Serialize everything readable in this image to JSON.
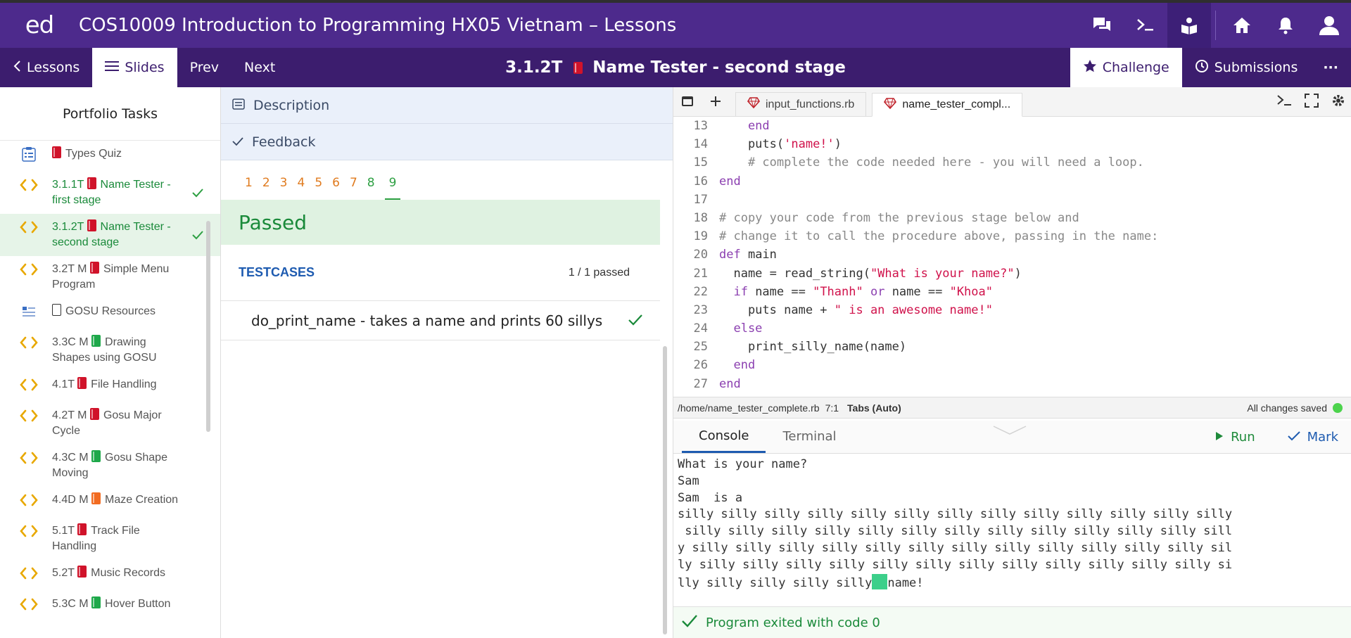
{
  "app": {
    "logo": "ed",
    "course_title": "COS10009 Introduction to Programming HX05 Vietnam – Lessons"
  },
  "subbar": {
    "lessons_label": "Lessons",
    "slides_label": "Slides",
    "prev_label": "Prev",
    "next_label": "Next",
    "slide_title_code": "3.1.2T",
    "slide_title_text": "Name Tester - second stage",
    "challenge_label": "Challenge",
    "submissions_label": "Submissions",
    "more_label": "···"
  },
  "sidebar": {
    "heading": "Portfolio Tasks",
    "items": [
      {
        "icon": "quiz-icon",
        "book": "red",
        "label": "Types Quiz",
        "active": false,
        "done": false
      },
      {
        "icon": "code-icon",
        "book": "red",
        "label_prefix": "3.1.1T",
        "label": "Name Tester - first stage",
        "active": false,
        "done": true
      },
      {
        "icon": "code-icon",
        "book": "red",
        "label_prefix": "3.1.2T",
        "label": "Name Tester - second stage",
        "active": true,
        "done": true
      },
      {
        "icon": "code-icon",
        "book": "red",
        "label_prefix": "3.2T M",
        "label": "Simple Menu Program",
        "active": false,
        "done": false
      },
      {
        "icon": "document-icon",
        "book": "outline",
        "label": "GOSU Resources",
        "active": false,
        "done": false
      },
      {
        "icon": "code-icon",
        "book": "green",
        "label_prefix": "3.3C M",
        "label": "Drawing Shapes using GOSU",
        "active": false,
        "done": false
      },
      {
        "icon": "code-icon",
        "book": "red",
        "label_prefix": "4.1T",
        "label": "File Handling",
        "active": false,
        "done": false
      },
      {
        "icon": "code-icon",
        "book": "red",
        "label_prefix": "4.2T M",
        "label": "Gosu Major Cycle",
        "active": false,
        "done": false
      },
      {
        "icon": "code-icon",
        "book": "green",
        "label_prefix": "4.3C M",
        "label": "Gosu Shape Moving",
        "active": false,
        "done": false
      },
      {
        "icon": "code-icon",
        "book": "orange",
        "label_prefix": "4.4D M",
        "label": "Maze Creation",
        "active": false,
        "done": false
      },
      {
        "icon": "code-icon",
        "book": "red",
        "label_prefix": "5.1T",
        "label": "Track File Handling",
        "active": false,
        "done": false
      },
      {
        "icon": "code-icon",
        "book": "red",
        "label_prefix": "5.2T",
        "label": "Music Records",
        "active": false,
        "done": false
      },
      {
        "icon": "code-icon",
        "book": "green",
        "label_prefix": "5.3C M",
        "label": "Hover Button",
        "active": false,
        "done": false
      }
    ]
  },
  "middle": {
    "description_label": "Description",
    "feedback_label": "Feedback",
    "attempts": [
      "1",
      "2",
      "3",
      "4",
      "5",
      "6",
      "7",
      "8",
      "9"
    ],
    "selected_attempt": "9",
    "status": "Passed",
    "testcases_label": "TESTCASES",
    "testcases_count": "1 / 1 passed",
    "testcases": [
      {
        "name": "do_print_name - takes a name and prints 60 sillys",
        "passed": true
      }
    ]
  },
  "editor": {
    "tabs": [
      "input_functions.rb",
      "name_tester_compl..."
    ],
    "active_tab": 1,
    "lines": [
      {
        "n": "13",
        "code": [
          [
            "kw",
            "    end"
          ]
        ]
      },
      {
        "n": "14",
        "code": [
          [
            "plain",
            "    puts("
          ],
          [
            "str",
            "'name!'"
          ],
          [
            "plain",
            ")"
          ]
        ]
      },
      {
        "n": "15",
        "code": [
          [
            "cm",
            "    # complete the code needed here - you will need a loop."
          ]
        ]
      },
      {
        "n": "16",
        "code": [
          [
            "kw",
            "end"
          ]
        ]
      },
      {
        "n": "17",
        "code": [
          [
            "plain",
            ""
          ]
        ]
      },
      {
        "n": "18",
        "code": [
          [
            "cm",
            "# copy your code from the previous stage below and"
          ]
        ]
      },
      {
        "n": "19",
        "code": [
          [
            "cm",
            "# change it to call the procedure above, passing in the name:"
          ]
        ]
      },
      {
        "n": "20",
        "code": [
          [
            "kw",
            "def"
          ],
          [
            "plain",
            " main"
          ]
        ]
      },
      {
        "n": "21",
        "code": [
          [
            "plain",
            "  name = read_string("
          ],
          [
            "str",
            "\"What is your name?\""
          ],
          [
            "plain",
            ")"
          ]
        ]
      },
      {
        "n": "22",
        "code": [
          [
            "kw",
            "  if"
          ],
          [
            "plain",
            " name == "
          ],
          [
            "str",
            "\"Thanh\""
          ],
          [
            "kw",
            " or"
          ],
          [
            "plain",
            " name == "
          ],
          [
            "str",
            "\"Khoa\""
          ]
        ]
      },
      {
        "n": "23",
        "code": [
          [
            "plain",
            "    puts name + "
          ],
          [
            "str",
            "\" is an awesome name!\""
          ]
        ]
      },
      {
        "n": "24",
        "code": [
          [
            "kw",
            "  else"
          ]
        ]
      },
      {
        "n": "25",
        "code": [
          [
            "plain",
            "    print_silly_name(name)"
          ]
        ]
      },
      {
        "n": "26",
        "code": [
          [
            "kw",
            "  end"
          ]
        ]
      },
      {
        "n": "27",
        "code": [
          [
            "kw",
            "end"
          ]
        ]
      }
    ],
    "status_path": "/home/name_tester_complete.rb",
    "status_pos": "7:1",
    "status_tabs": "Tabs (Auto)",
    "status_saved": "All changes saved"
  },
  "console": {
    "tabs": [
      "Console",
      "Terminal"
    ],
    "run_label": "Run",
    "mark_label": "Mark",
    "output_lines": [
      "What is your name?",
      "Sam",
      "Sam  is a",
      "silly silly silly silly silly silly silly silly silly silly silly silly silly",
      " silly silly silly silly silly silly silly silly silly silly silly silly sill",
      "y silly silly silly silly silly silly silly silly silly silly silly silly sil",
      "ly silly silly silly silly silly silly silly silly silly silly silly silly si"
    ],
    "last_line_before": "lly silly silly silly silly",
    "last_line_after": "name!",
    "exit_message": "Program exited with code 0"
  },
  "colors": {
    "topbar": "#4d2a8c",
    "subbar": "#3c1d6e",
    "pass_green": "#1a8a3a",
    "link_blue": "#1e5bb0"
  }
}
